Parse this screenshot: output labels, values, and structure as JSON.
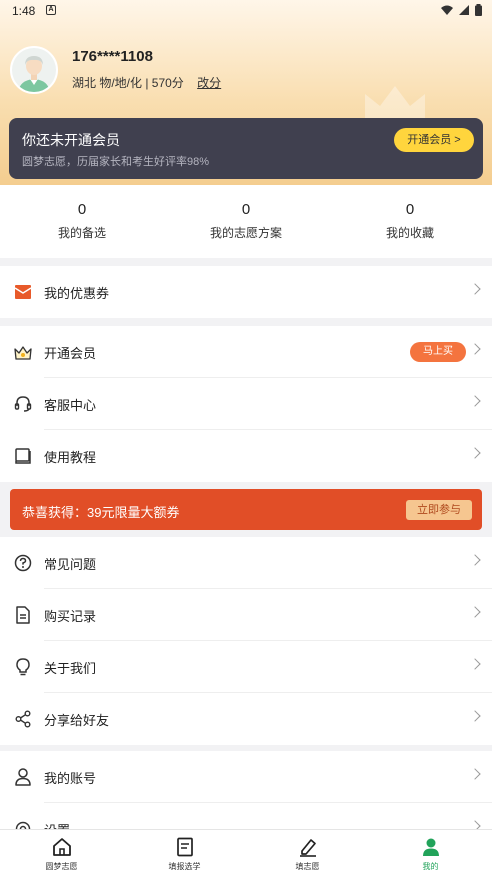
{
  "status_bar": {
    "time": "1:48",
    "notif_glyph": "A"
  },
  "profile": {
    "phone": "176****1108",
    "info": "湖北 物/地/化 | 570分",
    "edit_label": "改分"
  },
  "vip_card": {
    "title": "你还未开通会员",
    "subtitle": "圆梦志愿，历届家长和考生好评率98%",
    "button": "开通会员 >"
  },
  "stats": [
    {
      "value": "0",
      "label": "我的备选"
    },
    {
      "value": "0",
      "label": "我的志愿方案"
    },
    {
      "value": "0",
      "label": "我的收藏"
    }
  ],
  "menu1": [
    {
      "label": "我的优惠券",
      "icon": "coupon-icon"
    }
  ],
  "menu2": [
    {
      "label": "开通会员",
      "icon": "crown-icon",
      "badge": "马上买"
    },
    {
      "label": "客服中心",
      "icon": "headset-icon"
    },
    {
      "label": "使用教程",
      "icon": "book-icon"
    }
  ],
  "promo": {
    "text": "恭喜获得：39元限量大额券",
    "cta": "立即参与"
  },
  "menu3": [
    {
      "label": "常见问题",
      "icon": "question-icon"
    },
    {
      "label": "购买记录",
      "icon": "receipt-icon"
    },
    {
      "label": "关于我们",
      "icon": "bulb-icon"
    },
    {
      "label": "分享给好友",
      "icon": "share-icon"
    }
  ],
  "menu4": [
    {
      "label": "我的账号",
      "icon": "user-icon"
    },
    {
      "label": "设置",
      "icon": "settings-icon"
    }
  ],
  "tabbar": [
    {
      "label": "圆梦志愿",
      "icon": "home-icon"
    },
    {
      "label": "填报选学",
      "icon": "document-icon"
    },
    {
      "label": "填志愿",
      "icon": "pen-icon"
    },
    {
      "label": "我的",
      "icon": "person-icon",
      "active": true
    }
  ],
  "colors": {
    "accent_green": "#21a35a",
    "promo_red": "#e14e27",
    "vip_yellow": "#ffd53d",
    "vip_card_bg": "#40404f"
  }
}
